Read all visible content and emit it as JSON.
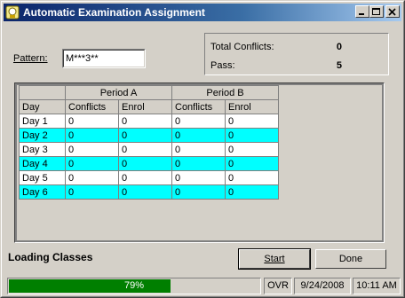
{
  "window": {
    "title": "Automatic Examination Assignment"
  },
  "pattern": {
    "label": "Pattern:",
    "value": "M***3**"
  },
  "stats": {
    "total_conflicts_label": "Total Conflicts:",
    "total_conflicts_value": "0",
    "pass_label": "Pass:",
    "pass_value": "5"
  },
  "grid": {
    "groups": [
      "Period A",
      "Period B"
    ],
    "columns": [
      "Day",
      "Conflicts",
      "Enrol",
      "Conflicts",
      "Enrol"
    ],
    "rows": [
      {
        "day": "Day 1",
        "values": [
          "0",
          "0",
          "0",
          "0"
        ],
        "highlight": false
      },
      {
        "day": "Day 2",
        "values": [
          "0",
          "0",
          "0",
          "0"
        ],
        "highlight": true
      },
      {
        "day": "Day 3",
        "values": [
          "0",
          "0",
          "0",
          "0"
        ],
        "highlight": false
      },
      {
        "day": "Day 4",
        "values": [
          "0",
          "0",
          "0",
          "0"
        ],
        "highlight": true
      },
      {
        "day": "Day 5",
        "values": [
          "0",
          "0",
          "0",
          "0"
        ],
        "highlight": false
      },
      {
        "day": "Day 6",
        "values": [
          "0",
          "0",
          "0",
          "0"
        ],
        "highlight": true
      }
    ],
    "highlight_color": "#00ffff"
  },
  "status_message": "Loading Classes",
  "buttons": {
    "start": "Start",
    "done": "Done"
  },
  "statusbar": {
    "progress_text": "79%",
    "progress_value": 0.79,
    "ovr": "OVR",
    "date": "9/24/2008",
    "time": "10:11 AM"
  },
  "colors": {
    "titlebar_start": "#0a246a",
    "progress": "#007f00"
  }
}
